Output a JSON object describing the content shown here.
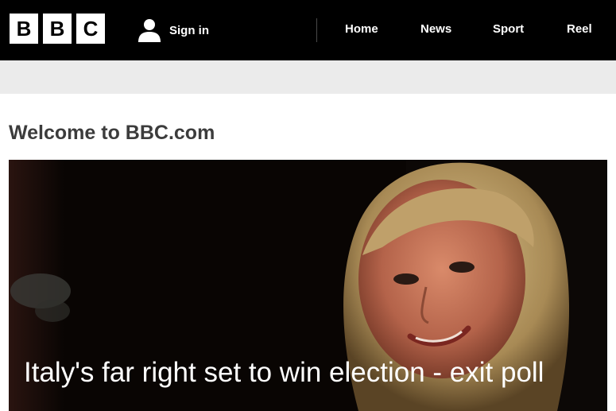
{
  "header": {
    "logo_letters": [
      "B",
      "B",
      "C"
    ],
    "signin_label": "Sign in",
    "signin_icon": "user-icon",
    "nav": [
      {
        "label": "Home"
      },
      {
        "label": "News"
      },
      {
        "label": "Sport"
      },
      {
        "label": "Reel"
      }
    ]
  },
  "main": {
    "welcome": "Welcome to BBC.com",
    "hero": {
      "headline": "Italy's far right set to win election - exit poll"
    }
  },
  "colors": {
    "header_bg": "#000000",
    "subbar_bg": "#ebebeb",
    "welcome_text": "#3c3c3c"
  }
}
